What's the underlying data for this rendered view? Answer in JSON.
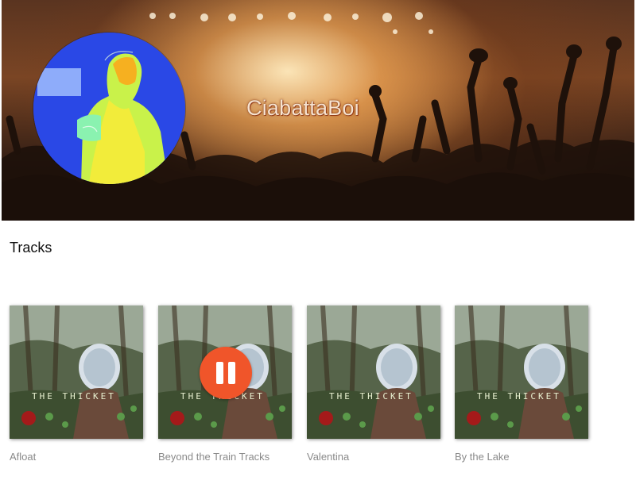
{
  "artist": {
    "name": "CiabattaBoi"
  },
  "section": {
    "title": "Tracks"
  },
  "tracks": [
    {
      "title": "Afloat",
      "state": "idle"
    },
    {
      "title": "Beyond the Train Tracks",
      "state": "playing"
    },
    {
      "title": "Valentina",
      "state": "idle"
    },
    {
      "title": "By the Lake",
      "state": "idle"
    }
  ],
  "cover_art": {
    "text": "THE THICKET"
  },
  "colors": {
    "play_button": "#f0552a",
    "track_title": "#8a8a8a",
    "artist_name": "#f7e3d0"
  },
  "icons": {
    "pause": "pause-icon"
  }
}
